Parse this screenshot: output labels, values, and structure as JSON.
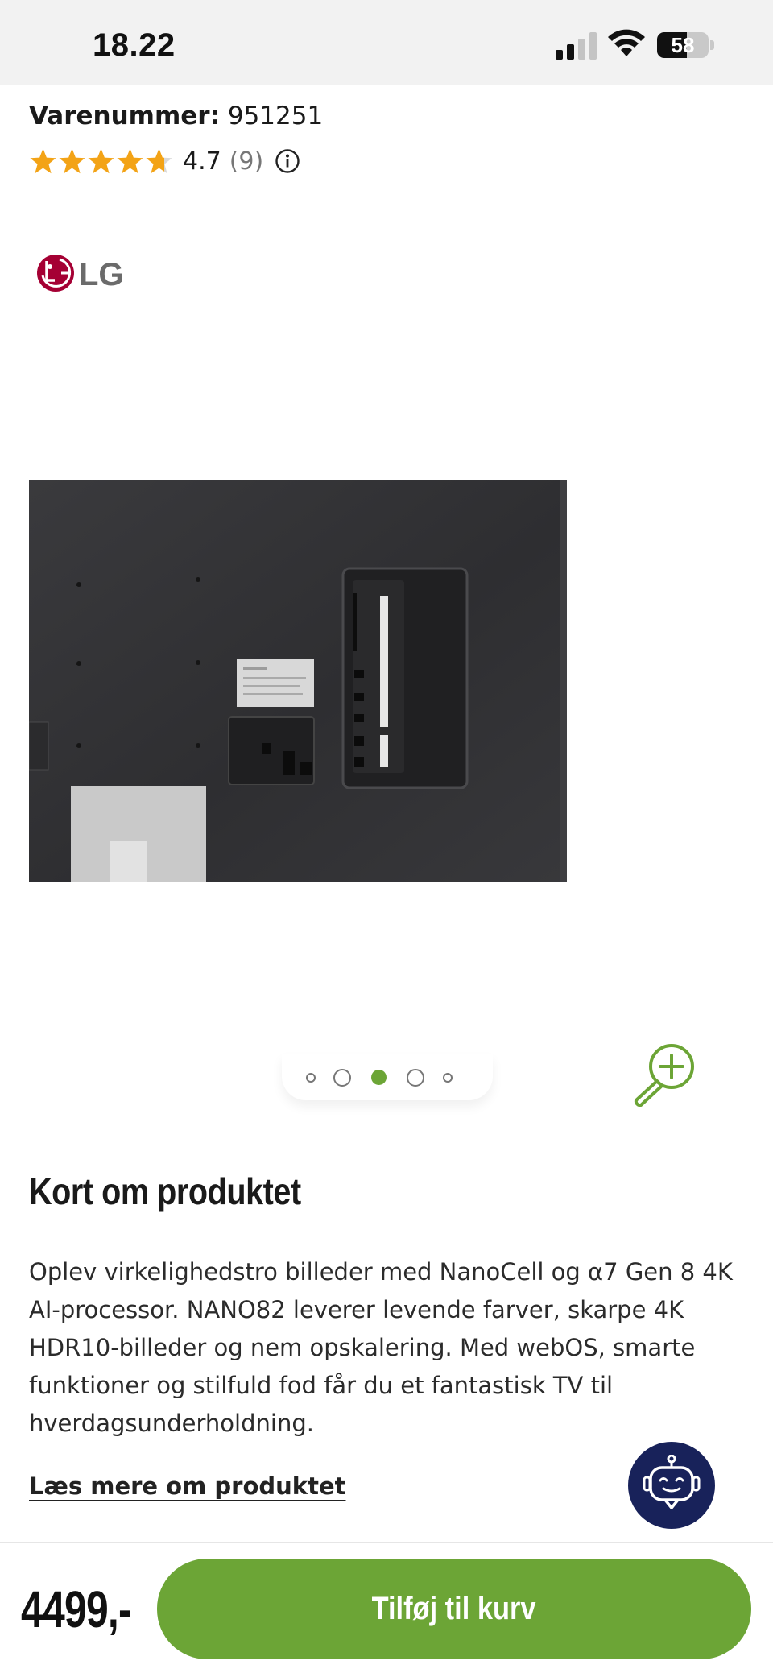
{
  "status_bar": {
    "time": "18.22",
    "battery_level": "58",
    "battery_fraction": 0.58,
    "icons": [
      "cellular-signal-icon",
      "wifi-icon",
      "battery-icon"
    ]
  },
  "product": {
    "sku_label": "Varenummer:",
    "sku_value": "951251",
    "rating_value": "4.7",
    "rating_count": "(9)",
    "stars_filled": 4.7,
    "stars_total": 5,
    "brand": "LG",
    "image_alt": "LG NanoCell TV back panel",
    "carousel": {
      "total": 5,
      "active_index": 2
    }
  },
  "section": {
    "title": "Kort om produktet",
    "description": "Oplev virkelighedstro billeder med NanoCell og α7 Gen 8 4K AI-processor. NANO82 leverer levende farver, skarpe 4K HDR10-billeder og nem opskalering. Med webOS, smarte funktioner og stilfuld fod får du et fantastisk TV til hverdagsunderholdning.",
    "read_more": "Læs mere om produktet"
  },
  "bottom_bar": {
    "price": "4499,-",
    "add_to_cart_label": "Tilføj til kurv"
  },
  "colors": {
    "accent_green": "#6ca536",
    "star_orange": "#f3a316",
    "chatbot_navy": "#18225a",
    "lg_red": "#a50034",
    "dot_active": "#6ca536"
  }
}
